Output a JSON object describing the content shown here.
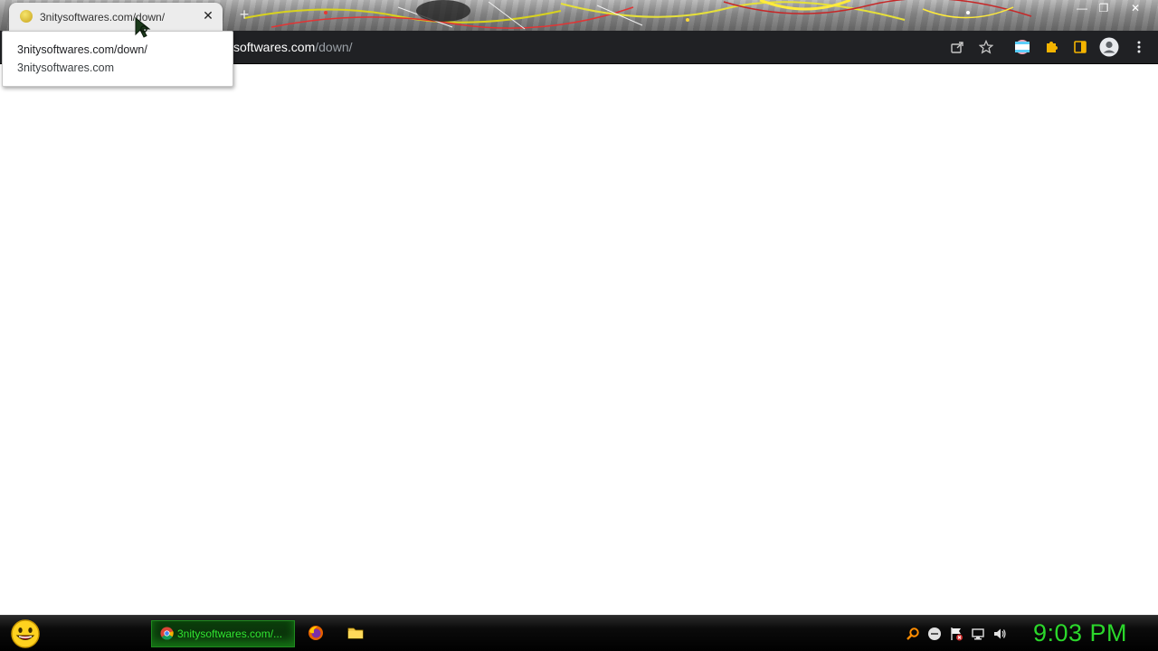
{
  "browser": {
    "tab": {
      "title": "3nitysoftwares.com/down/",
      "close_glyph": "✕",
      "favicon": "smiley-favicon-icon"
    },
    "new_tab_glyph": "+",
    "window_controls": {
      "minimize": "—",
      "restore": "❐",
      "close": "✕"
    },
    "address": {
      "host_visible": "softwares.com",
      "path": "/down/"
    },
    "toolbar_icons": [
      "share-icon",
      "bookmark-star-icon",
      "profile-flag-icon",
      "extensions-puzzle-icon",
      "side-panel-icon",
      "account-avatar-icon",
      "menu-kebab-icon"
    ],
    "hover_card": {
      "title": "3nitysoftwares.com/down/",
      "domain": "3nitysoftwares.com"
    },
    "colors": {
      "toolbar_bg": "#202124",
      "tab_bg": "#ececec",
      "extension_icon": "#f4b400",
      "side_panel_icon": "#f4b400"
    }
  },
  "taskbar": {
    "start_icon": "smiley-start-icon",
    "active_task": {
      "label": "3nitysoftwares.com/...",
      "icon": "chrome-icon"
    },
    "pinned": [
      "firefox-icon",
      "folder-icon"
    ],
    "tray_icons": [
      "search-icon",
      "minus-circle-icon",
      "flag-icon",
      "network-icon",
      "volume-icon"
    ],
    "clock": "9:03 PM",
    "colors": {
      "clock": "#2bd72b",
      "task_label": "#31e531"
    }
  }
}
